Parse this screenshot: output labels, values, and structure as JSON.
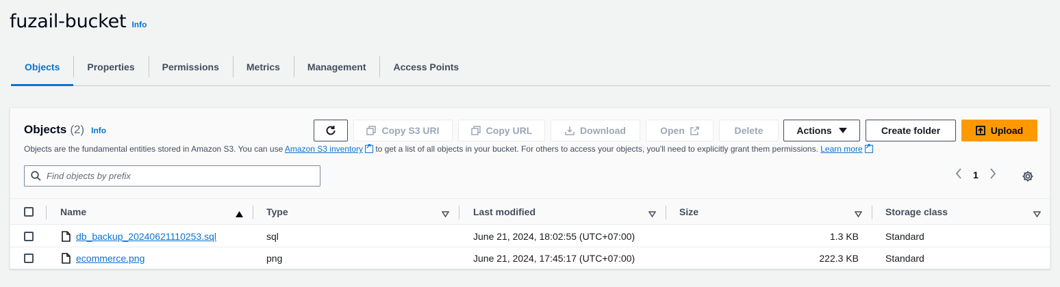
{
  "bucket": {
    "name": "fuzail-bucket",
    "info_label": "Info"
  },
  "tabs": [
    {
      "label": "Objects",
      "active": true
    },
    {
      "label": "Properties"
    },
    {
      "label": "Permissions"
    },
    {
      "label": "Metrics"
    },
    {
      "label": "Management"
    },
    {
      "label": "Access Points"
    }
  ],
  "objects_panel": {
    "title": "Objects",
    "count": "(2)",
    "info_label": "Info",
    "description": {
      "part1": "Objects are the fundamental entities stored in Amazon S3. You can use ",
      "link1": "Amazon S3 inventory",
      "part2": " to get a list of all objects in your bucket. For others to access your objects, you'll need to explicitly grant them permissions. ",
      "link2": "Learn more"
    },
    "toolbar": {
      "refresh_icon": "refresh-icon",
      "copy_s3_uri": "Copy S3 URI",
      "copy_url": "Copy URL",
      "download": "Download",
      "open": "Open",
      "delete": "Delete",
      "actions": "Actions",
      "create_folder": "Create folder",
      "upload": "Upload"
    },
    "search": {
      "placeholder": "Find objects by prefix",
      "value": ""
    },
    "pagination": {
      "current_page": "1"
    }
  },
  "table": {
    "columns": [
      "Name",
      "Type",
      "Last modified",
      "Size",
      "Storage class"
    ],
    "rows": [
      {
        "name": "db_backup_20240621110253.sql",
        "type": "sql",
        "last_modified": "June 21, 2024, 18:02:55 (UTC+07:00)",
        "size": "1.3 KB",
        "storage_class": "Standard"
      },
      {
        "name": "ecommerce.png",
        "type": "png",
        "last_modified": "June 21, 2024, 17:45:17 (UTC+07:00)",
        "size": "222.3 KB",
        "storage_class": "Standard"
      }
    ]
  },
  "colors": {
    "accent": "#0972d3",
    "primary_button": "#ff9900",
    "background": "#f2f3f3"
  }
}
